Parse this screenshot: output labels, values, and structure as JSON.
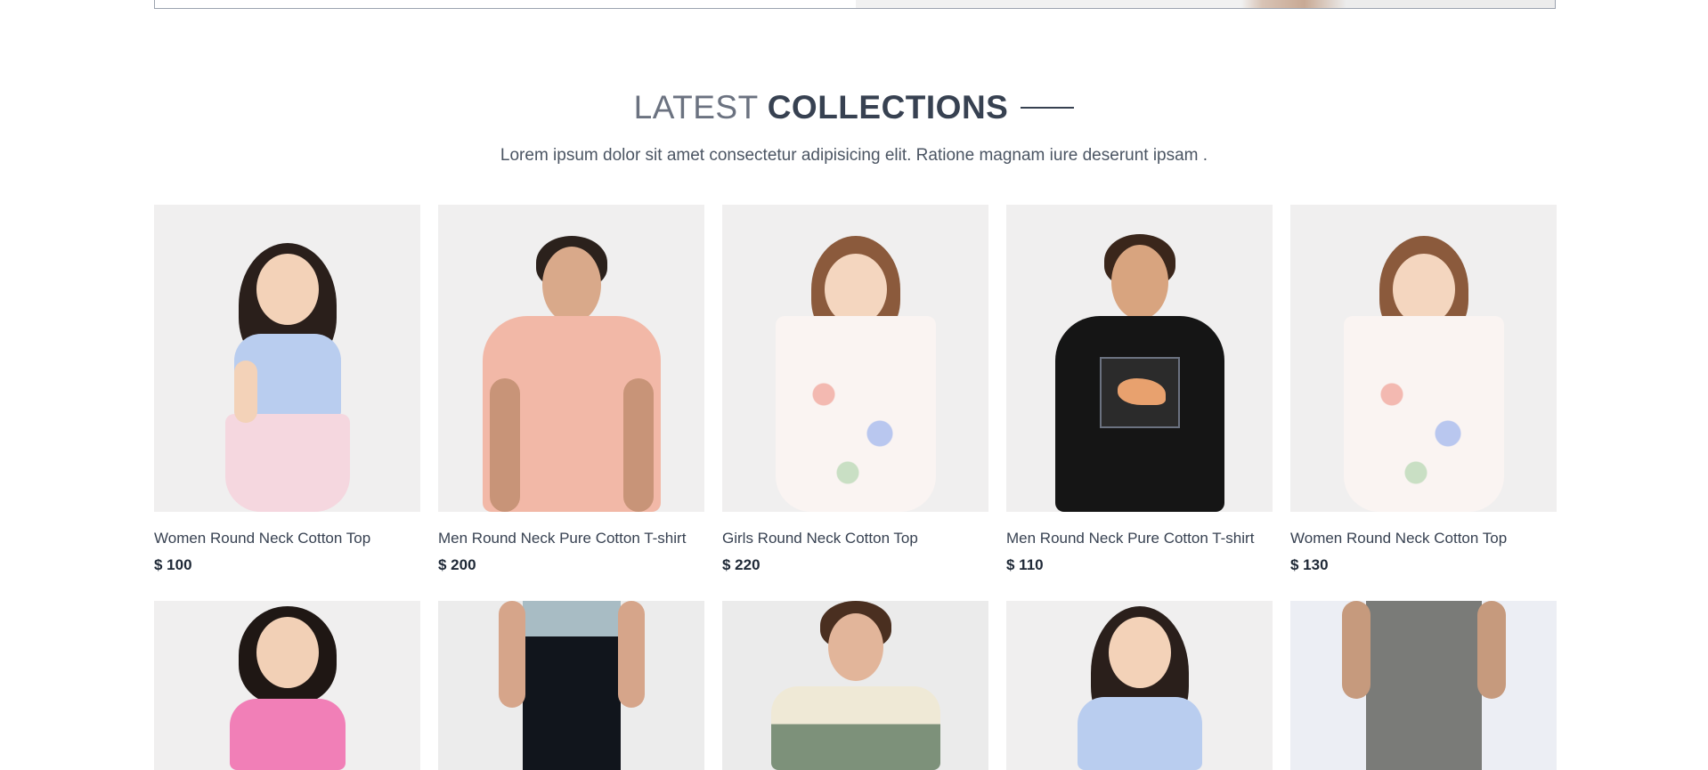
{
  "section": {
    "title_light": "LATEST",
    "title_strong": "COLLECTIONS",
    "subtitle": "Lorem ipsum dolor sit amet consectetur adipisicing elit. Ratione magnam iure deserunt ipsam ."
  },
  "products_row1": [
    {
      "name": "Women Round Neck Cotton Top",
      "price": "$ 100",
      "image": "girl-blue-top"
    },
    {
      "name": "Men Round Neck Pure Cotton T-shirt",
      "price": "$ 200",
      "image": "man-pink-polo"
    },
    {
      "name": "Girls Round Neck Cotton Top",
      "price": "$ 220",
      "image": "girl-floral-dress"
    },
    {
      "name": "Men Round Neck Pure Cotton T-shirt",
      "price": "$ 110",
      "image": "man-black-tshirt"
    },
    {
      "name": "Women Round Neck Cotton Top",
      "price": "$ 130",
      "image": "girl-floral-dress"
    }
  ],
  "products_row2": [
    {
      "image": "girl-pink-top"
    },
    {
      "image": "man-black-jeans"
    },
    {
      "image": "man-green-polo"
    },
    {
      "image": "girl-blue-top"
    },
    {
      "image": "man-grey-cargo"
    }
  ],
  "colors": {
    "accent_text": "#374151",
    "muted_text": "#6b7280",
    "card_bg": "#f0efef"
  }
}
